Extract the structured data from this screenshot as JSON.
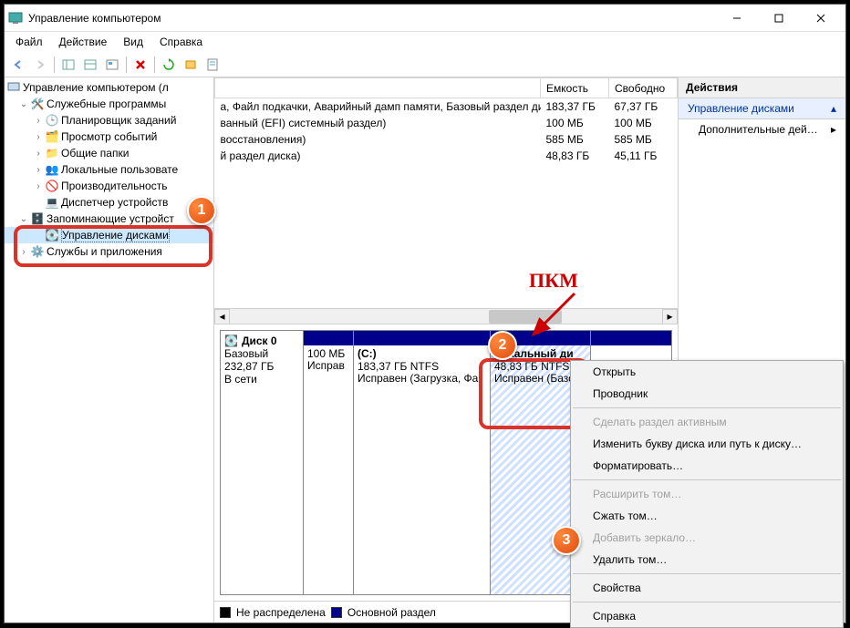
{
  "window": {
    "title": "Управление компьютером"
  },
  "menu": {
    "file": "Файл",
    "action": "Действие",
    "view": "Вид",
    "help": "Справка"
  },
  "tree": {
    "root": "Управление компьютером (л",
    "services_group": "Служебные программы",
    "task_scheduler": "Планировщик заданий",
    "event_viewer": "Просмотр событий",
    "shared_folders": "Общие папки",
    "local_users": "Локальные пользовате",
    "performance": "Производительность",
    "device_manager": "Диспетчер устройств",
    "storage": "Запоминающие устройст",
    "disk_mgmt": "Управление дисками",
    "services_apps": "Службы и приложения"
  },
  "columns": {
    "desc": "",
    "capacity": "Емкость",
    "free": "Свободно"
  },
  "volumes": [
    {
      "desc": "а, Файл подкачки, Аварийный дамп памяти, Базовый раздел диска)",
      "capacity": "183,37 ГБ",
      "free": "67,37 ГБ"
    },
    {
      "desc": "ванный (EFI) системный раздел)",
      "capacity": "100 МБ",
      "free": "100 МБ"
    },
    {
      "desc": "восстановления)",
      "capacity": "585 МБ",
      "free": "585 МБ"
    },
    {
      "desc": "й раздел диска)",
      "capacity": "48,83 ГБ",
      "free": "45,11 ГБ"
    }
  ],
  "disk": {
    "name": "Диск 0",
    "type": "Базовый",
    "size": "232,87 ГБ",
    "status": "В сети",
    "parts": [
      {
        "title": "",
        "line1": "100 МБ",
        "line2": "Исправ"
      },
      {
        "title": "(C:)",
        "line1": "183,37 ГБ NTFS",
        "line2": "Исправен (Загрузка, Фа"
      },
      {
        "title": "Локальный ди",
        "line1": "48,83 ГБ NTFS",
        "line2": "Исправен (Базо"
      }
    ]
  },
  "legend": {
    "unalloc": "Не распределена",
    "primary": "Основной раздел"
  },
  "actions": {
    "header": "Действия",
    "disk_mgmt": "Управление дисками",
    "more": "Дополнительные дей…"
  },
  "context": {
    "open": "Открыть",
    "explorer": "Проводник",
    "make_active": "Сделать раздел активным",
    "change_letter": "Изменить букву диска или путь к диску…",
    "format": "Форматировать…",
    "extend": "Расширить том…",
    "shrink": "Сжать том…",
    "add_mirror": "Добавить зеркало…",
    "delete": "Удалить том…",
    "properties": "Свойства",
    "help": "Справка"
  },
  "callouts": {
    "n1": "1",
    "n2": "2",
    "n3": "3",
    "pkm": "ПКМ"
  }
}
